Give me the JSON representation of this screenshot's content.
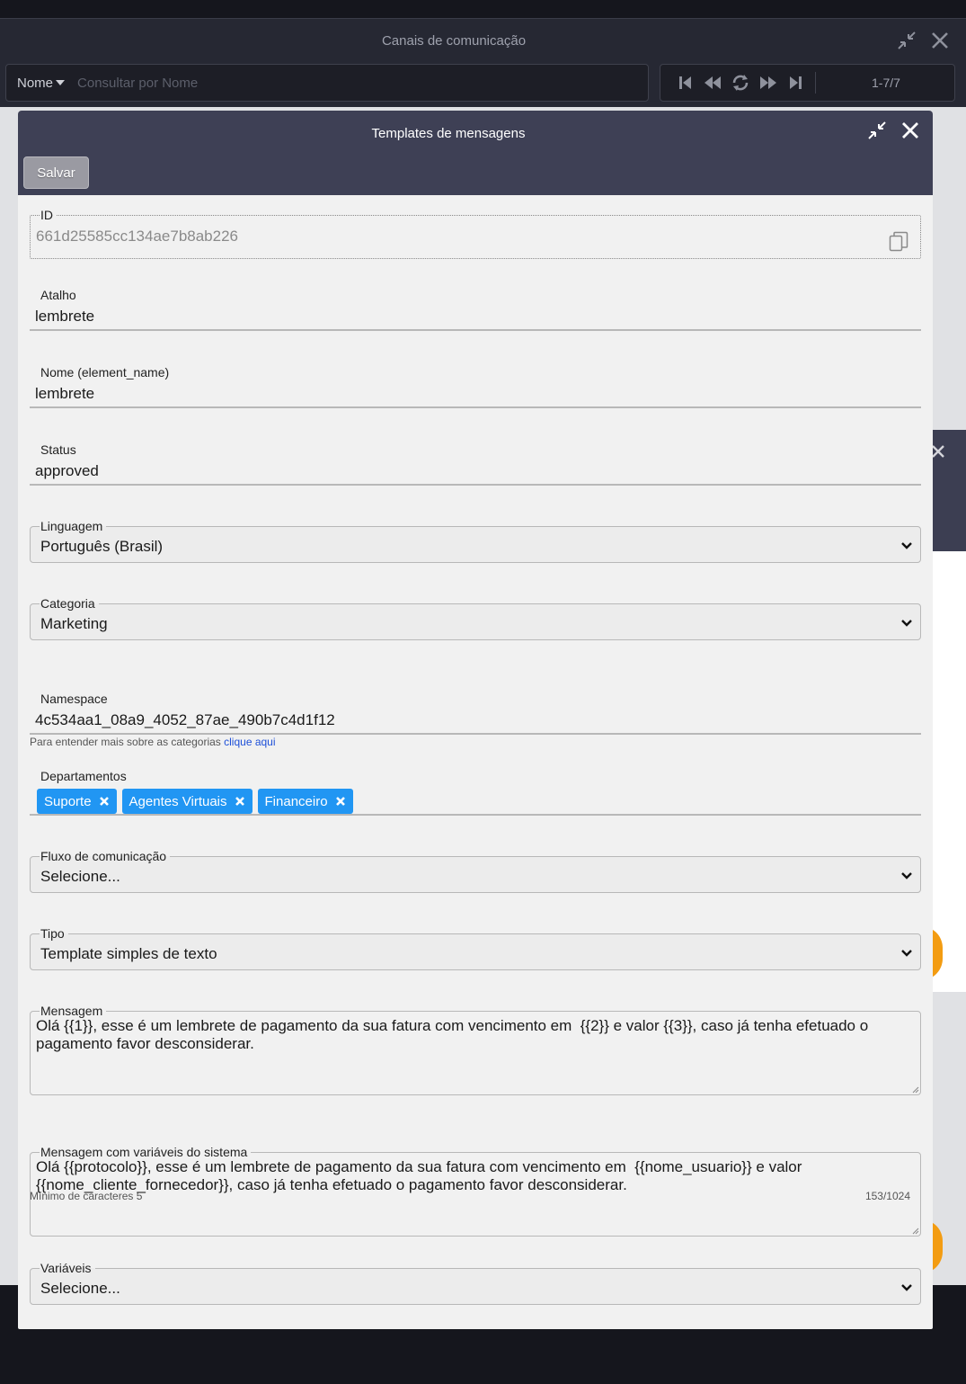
{
  "background_window": {
    "title": "Canais de comunicação",
    "search": {
      "field_selector": "Nome",
      "placeholder": "Consultar por Nome"
    },
    "pager": {
      "count": "1-7/7"
    }
  },
  "modal": {
    "title": "Templates de mensagens",
    "save_label": "Salvar"
  },
  "form": {
    "id": {
      "label": "ID",
      "value": "661d25585cc134ae7b8ab226"
    },
    "atalho": {
      "label": "Atalho",
      "value": "lembrete"
    },
    "nome": {
      "label": "Nome (element_name)",
      "value": "lembrete"
    },
    "status": {
      "label": "Status",
      "value": "approved"
    },
    "linguagem": {
      "label": "Linguagem",
      "value": "Português (Brasil)"
    },
    "categoria": {
      "label": "Categoria",
      "value": "Marketing",
      "help_text": "Para entender mais sobre as categorias",
      "help_link": "clique aqui"
    },
    "namespace": {
      "label": "Namespace",
      "value": "4c534aa1_08a9_4052_87ae_490b7c4d1f12"
    },
    "departamentos": {
      "label": "Departamentos",
      "chips": [
        {
          "label": "Suporte"
        },
        {
          "label": "Agentes Virtuais"
        },
        {
          "label": "Financeiro"
        }
      ]
    },
    "fluxo": {
      "label": "Fluxo de comunicação",
      "value": "Selecione..."
    },
    "tipo": {
      "label": "Tipo",
      "value": "Template simples de texto"
    },
    "mensagem": {
      "label": "Mensagem",
      "value": "Olá {{1}}, esse é um lembrete de pagamento da sua fatura com vencimento em  {{2}} e valor {{3}}, caso já tenha efetuado o pagamento favor desconsiderar.",
      "min_text": "Mínimo de caracteres 5",
      "counter": "153/1024"
    },
    "mensagem_sistema": {
      "label": "Mensagem com variáveis do sistema",
      "value": "Olá {{protocolo}}, esse é um lembrete de pagamento da sua fatura com vencimento em  {{nome_usuario}} e valor {{nome_cliente_fornecedor}}, caso já tenha efetuado o pagamento favor desconsiderar."
    },
    "variaveis": {
      "label": "Variáveis",
      "value": "Selecione..."
    }
  },
  "colors": {
    "modal_header": "#3e4055",
    "chip": "#2196f3",
    "link": "#1d4fd8",
    "accent_orange": "#f39c12"
  },
  "icons": [
    "minimize-icon",
    "close-icon",
    "caret-down-icon",
    "first-page-icon",
    "rewind-icon",
    "refresh-icon",
    "fast-forward-icon",
    "last-page-icon",
    "copy-icon",
    "chevron-down-icon",
    "chip-remove-icon",
    "resize-handle-icon"
  ]
}
